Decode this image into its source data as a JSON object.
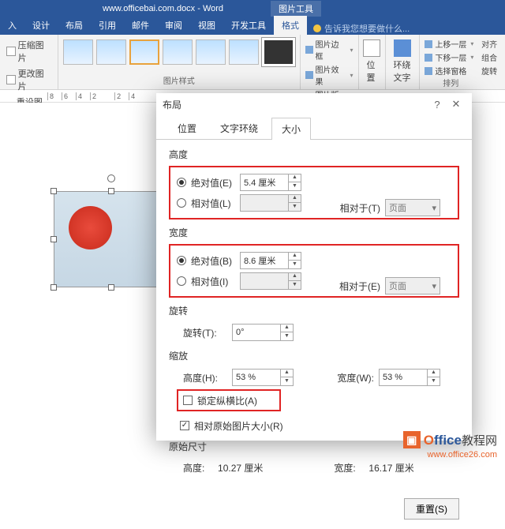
{
  "titlebar": {
    "doc": "www.officebai.com.docx - Word",
    "tools": "图片工具"
  },
  "ribbon_tabs": [
    "入",
    "设计",
    "布局",
    "引用",
    "邮件",
    "审阅",
    "视图",
    "开发工具",
    "格式"
  ],
  "tell_me": "告诉我您想要做什么...",
  "adjust": {
    "compress": "压缩图片",
    "change": "更改图片",
    "reset": "重设图片"
  },
  "styles_label": "图片样式",
  "picfmt": {
    "border": "图片边框",
    "effects": "图片效果",
    "layout": "图片版式"
  },
  "arrange": {
    "position": "位置",
    "wrap": "环绕文字",
    "forward": "上移一层",
    "backward": "下移一层",
    "pane": "选择窗格",
    "label": "排列",
    "align": "对齐",
    "group": "组合",
    "rotate": "旋转"
  },
  "ruler": [
    "8",
    "6",
    "4",
    "2",
    "",
    "2",
    "4"
  ],
  "dialog": {
    "title": "布局",
    "tabs": [
      "位置",
      "文字环绕",
      "大小"
    ],
    "height": {
      "title": "高度",
      "abs": "绝对值(E)",
      "abs_val": "5.4 厘米",
      "rel": "相对值(L)",
      "rel_to_lbl": "相对于(T)",
      "rel_to_val": "页面"
    },
    "width": {
      "title": "宽度",
      "abs": "绝对值(B)",
      "abs_val": "8.6 厘米",
      "rel": "相对值(I)",
      "rel_to_lbl": "相对于(E)",
      "rel_to_val": "页面"
    },
    "rotate": {
      "title": "旋转",
      "lbl": "旋转(T):",
      "val": "0°"
    },
    "scale": {
      "title": "缩放",
      "h_lbl": "高度(H):",
      "h_val": "53 %",
      "w_lbl": "宽度(W):",
      "w_val": "53 %",
      "lock": "锁定纵横比(A)",
      "orig": "相对原始图片大小(R)"
    },
    "orig_size": {
      "title": "原始尺寸",
      "h_lbl": "高度:",
      "h_val": "10.27 厘米",
      "w_lbl": "宽度:",
      "w_val": "16.17 厘米"
    },
    "reset": "重置(S)"
  },
  "wm": {
    "brand1": "O",
    "brand2": "ffice",
    "brand3": "教程网",
    "url": "www.office26.com"
  }
}
